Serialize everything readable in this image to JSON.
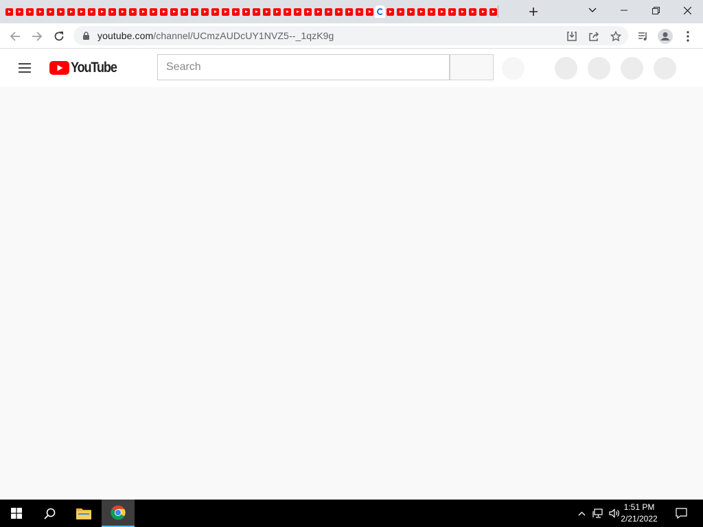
{
  "browser": {
    "tab_count": 48,
    "active_tab_index": 36,
    "new_tab_icon": "plus-icon",
    "url_host": "youtube.com",
    "url_path": "/channel/UCmzAUDcUY1NVZ5--_1qzK9g"
  },
  "youtube": {
    "logo_text": "YouTube",
    "search_placeholder": "Search",
    "brand_color": "#ff0000"
  },
  "taskbar": {
    "time": "1:51 PM",
    "date": "2/21/2022"
  }
}
